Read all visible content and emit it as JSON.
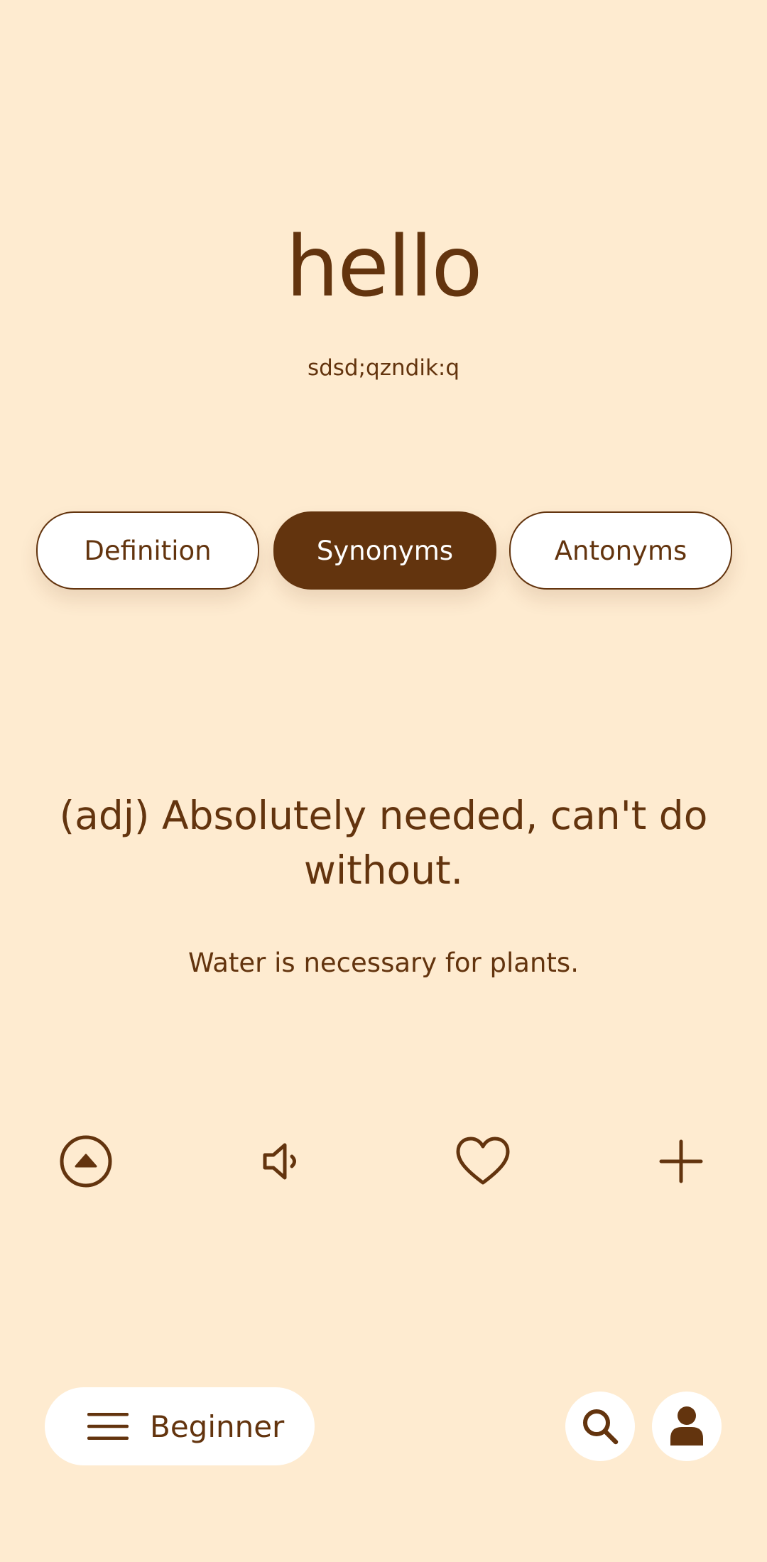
{
  "word": {
    "title": "hello",
    "phonetic": "sdsd;qzndik:q"
  },
  "tabs": [
    {
      "label": "Definition",
      "active": false
    },
    {
      "label": "Synonyms",
      "active": true
    },
    {
      "label": "Antonyms",
      "active": false
    }
  ],
  "content": {
    "meaning": "(adj) Absolutely needed, can't do without.",
    "example": "Water is necessary for plants."
  },
  "actions": [
    {
      "icon": "eject-icon"
    },
    {
      "icon": "speaker-icon"
    },
    {
      "icon": "heart-icon"
    },
    {
      "icon": "plus-icon"
    }
  ],
  "bottom_bar": {
    "level_label": "Beginner",
    "menu_icon": "hamburger-icon",
    "search_icon": "search-icon",
    "profile_icon": "user-icon"
  },
  "theme": {
    "background": "#FEEBD0",
    "accent": "#63340E",
    "surface": "#FFFFFF"
  }
}
